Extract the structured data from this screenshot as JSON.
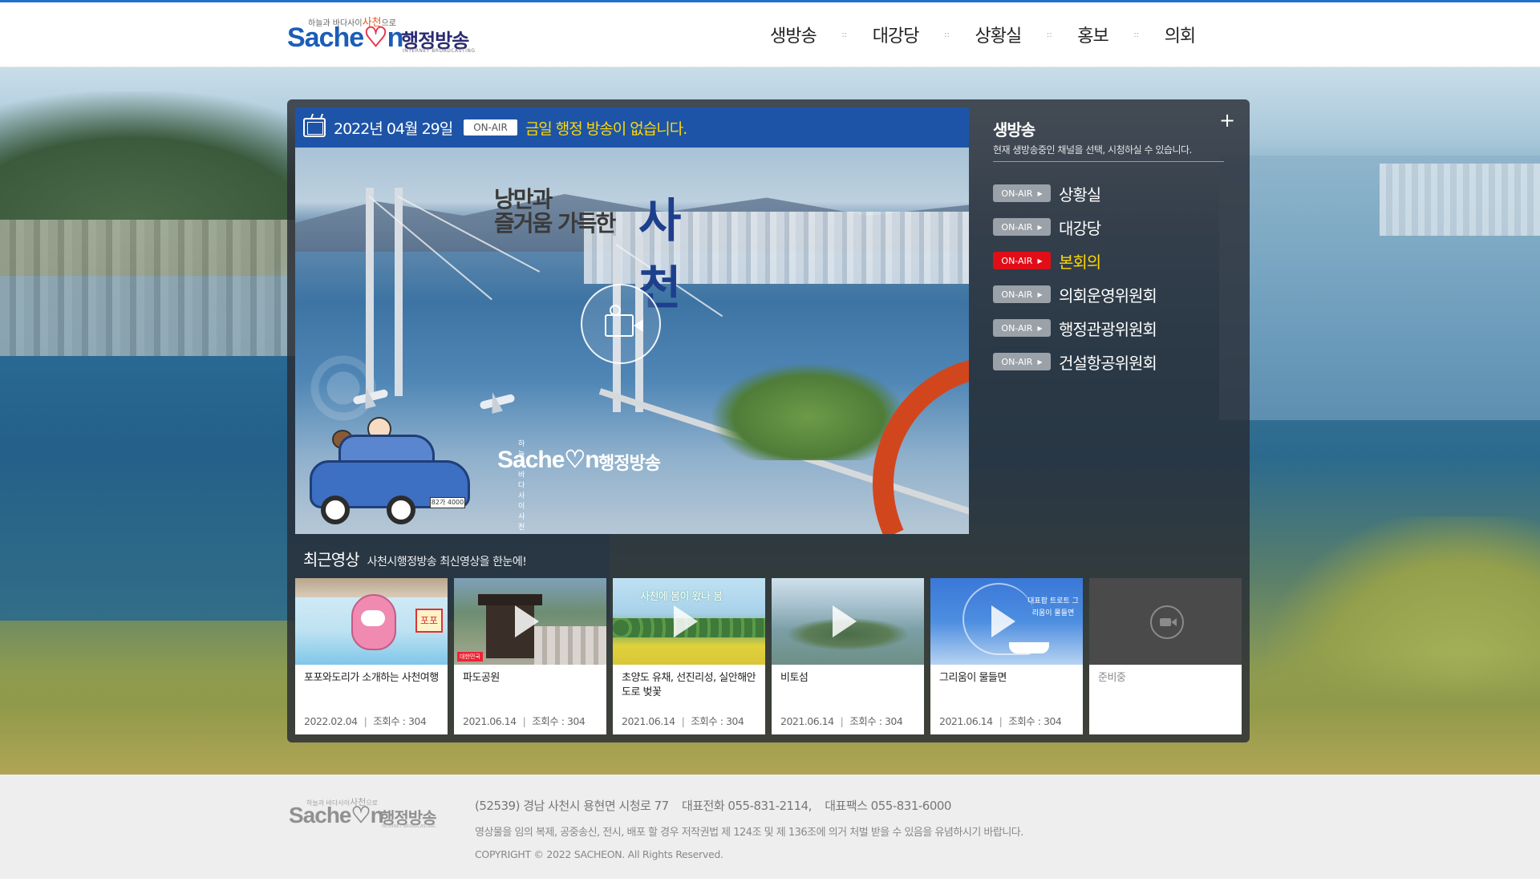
{
  "header": {
    "logo": {
      "tagline_pre": "하늘과 바다사이",
      "tagline_mid": "사천",
      "tagline_post": "으로",
      "word_pre": "Sache",
      "word_heart": "♡",
      "word_post": "n",
      "korean": "행정방송",
      "sub": "INTERNET BROADCASTING"
    },
    "nav": [
      "생방송",
      "대강당",
      "상황실",
      "홍보",
      "의회"
    ],
    "nav_separator": "::"
  },
  "player": {
    "date": "2022년 04월 29일",
    "onair_badge": "ON-AIR",
    "message": "금일 행정 방송이 없습니다.",
    "slogan_line1": "낭만과",
    "slogan_line2": "즐거움 가득한",
    "slogan_big": "사천",
    "car_plate": "82가 4000"
  },
  "live": {
    "title": "생방송",
    "plus": "+",
    "description": "현재 생방송중인 채널을 선택, 시청하실 수 있습니다.",
    "badge_label": "ON-AIR",
    "channels": [
      {
        "name": "상황실",
        "active": false
      },
      {
        "name": "대강당",
        "active": false
      },
      {
        "name": "본회의",
        "active": true
      },
      {
        "name": "의회운영위원회",
        "active": false
      },
      {
        "name": "행정관광위원회",
        "active": false
      },
      {
        "name": "건설항공위원회",
        "active": false
      }
    ]
  },
  "recent": {
    "title": "최근영상",
    "subtitle": "사천시행정방송 최신영상을 한눈에!",
    "meta_label": "조회수",
    "videos": [
      {
        "title": "포포와도리가 소개하는 사천여행",
        "date": "2022.02.04",
        "views": "304",
        "thumb_sign": "포포"
      },
      {
        "title": "파도공원",
        "date": "2021.06.14",
        "views": "304",
        "thumb_label": "대한민국"
      },
      {
        "title": "초양도 유채, 선진리성, 실안해안도로 벚꽃",
        "date": "2021.06.14",
        "views": "304",
        "thumb_text": "사천에 봄이 왔나 봄"
      },
      {
        "title": "비토섬",
        "date": "2021.06.14",
        "views": "304"
      },
      {
        "title": "그리움이 물들면",
        "date": "2021.06.14",
        "views": "304",
        "thumb_text": "대표팝 트로트 그리움이 물들면"
      },
      {
        "title": "준비중"
      }
    ]
  },
  "footer": {
    "address": "(52539) 경남 사천시 용현면 시청로 77",
    "phone": "대표전화 055-831-2114,",
    "fax": "대표팩스 055-831-6000",
    "notice": "영상물을 임의 복제, 공중송신, 전시, 배포 할 경우 저작권법 제 124조 및 제 136조에 의거 처벌 받을 수 있음을 유념하시기 바랍니다.",
    "copyright": "COPYRIGHT © 2022 SACHEON. All Rights Reserved."
  }
}
